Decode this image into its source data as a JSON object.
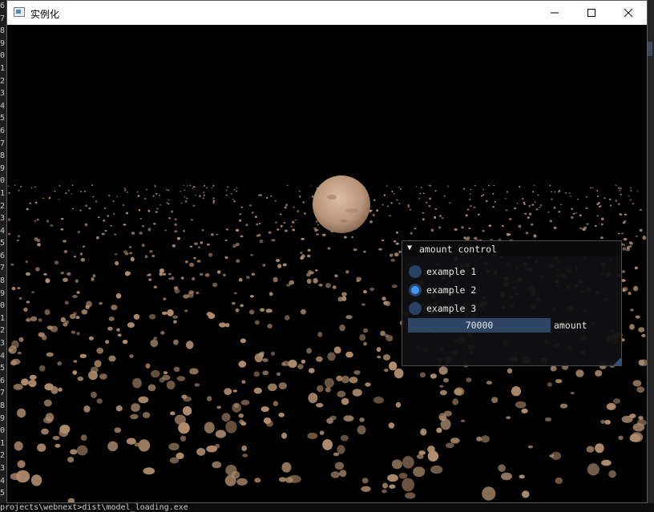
{
  "window": {
    "title": "实例化",
    "icon": "app-window-icon",
    "controls": {
      "minimize": "minimize-icon",
      "maximize": "maximize-icon",
      "close": "close-icon"
    }
  },
  "scene": {
    "planet_color": "#c9a487",
    "asteroid_color": "#b08d6e",
    "background": "#000000"
  },
  "panel": {
    "title": "amount control",
    "collapse_icon": "▼",
    "options": [
      {
        "label": "example 1",
        "selected": false
      },
      {
        "label": "example 2",
        "selected": true
      },
      {
        "label": "example 3",
        "selected": false
      }
    ],
    "slider": {
      "value": "70000",
      "label": "amount"
    },
    "colors": {
      "accent": "#4296fa",
      "frame": "#294163",
      "slider": "#2d4563"
    }
  },
  "background_console": {
    "gutter_digits": [
      "6",
      "7",
      "8",
      "9",
      "0",
      "1",
      "2",
      "3",
      "4",
      "5",
      "6",
      "7",
      "8",
      "9",
      "0",
      "1",
      "2",
      "3",
      "4",
      "5",
      "6",
      "7",
      "8",
      "9",
      "0",
      "1",
      "2",
      "3",
      "4",
      "5",
      "6",
      "7",
      "8",
      "9",
      "0",
      "1",
      "2",
      "3",
      "4",
      "5"
    ],
    "bottom_line": "projects\\webnext>dist\\model_loading.exe"
  }
}
